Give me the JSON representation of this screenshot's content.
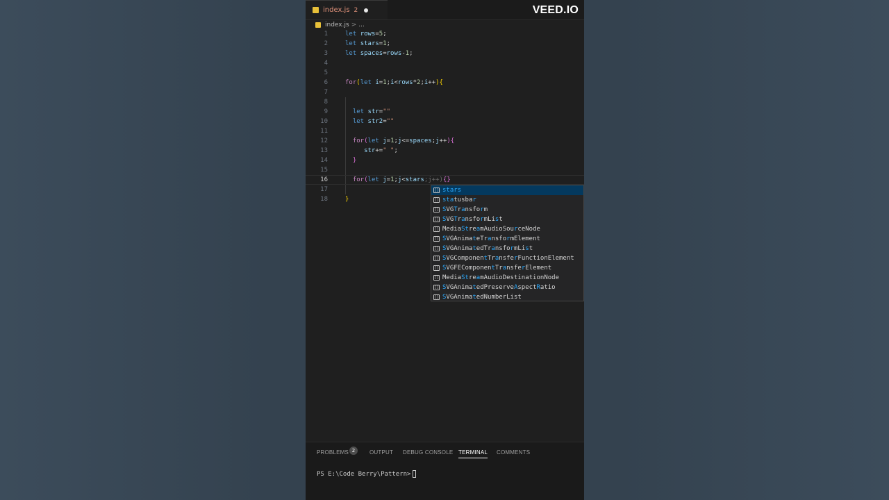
{
  "watermark": "VEED.IO",
  "tab": {
    "filename": "index.js",
    "problem_count": "2"
  },
  "breadcrumb": {
    "file": "index.js",
    "separator": ">",
    "more": "..."
  },
  "editor": {
    "line_numbers": [
      "1",
      "2",
      "3",
      "4",
      "5",
      "6",
      "7",
      "8",
      "9",
      "10",
      "11",
      "12",
      "13",
      "14",
      "15",
      "16",
      "17",
      "18"
    ],
    "active_line": "16"
  },
  "suggestions": [
    "stars",
    "statusbar",
    "SVGTransform",
    "SVGTransformList",
    "MediaStreamAudioSourceNode",
    "SVGAnimateTransformElement",
    "SVGAnimatedTransformList",
    "SVGComponentTransferFunctionElement",
    "SVGFEComponentTransferElement",
    "MediaStreamAudioDestinationNode",
    "SVGAnimatedPreserveAspectRatio",
    "SVGAnimatedNumberList"
  ],
  "suggestion_icon": "variable-icon",
  "panel": {
    "tabs": [
      "PROBLEMS",
      "OUTPUT",
      "DEBUG CONSOLE",
      "TERMINAL",
      "COMMENTS"
    ],
    "problems_badge": "2",
    "active_tab": "TERMINAL",
    "prompt": "PS E:\\Code Berry\\Pattern>"
  }
}
